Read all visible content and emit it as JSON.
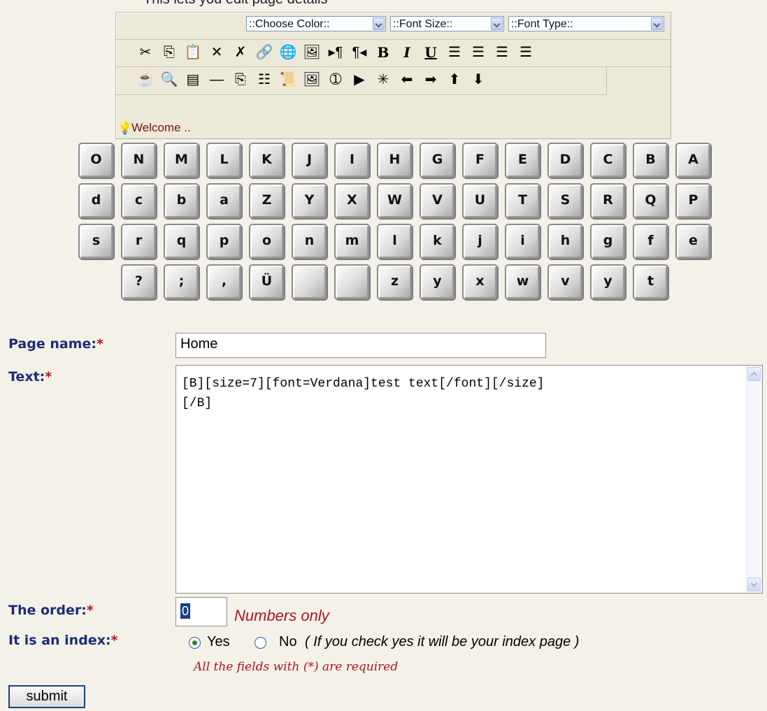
{
  "top_note": "This lets you edit page details",
  "editor": {
    "color_select": "::Choose Color::",
    "size_select": "::Font Size::",
    "type_select": "::Font Type::",
    "status": "Welcome .."
  },
  "toolbar1": [
    {
      "name": "cut-icon",
      "glyph": "✂"
    },
    {
      "name": "copy-icon",
      "glyph": "⎘"
    },
    {
      "name": "paste-icon",
      "glyph": "📋"
    },
    {
      "name": "delete-icon",
      "glyph": "✕"
    },
    {
      "name": "spellcheck-icon",
      "glyph": "✗"
    },
    {
      "name": "link-icon",
      "glyph": "🔗"
    },
    {
      "name": "web-icon",
      "glyph": "🌐"
    },
    {
      "name": "image-icon",
      "glyph": "🖼"
    },
    {
      "name": "ltr-icon",
      "glyph": "▸¶"
    },
    {
      "name": "rtl-icon",
      "glyph": "¶◂"
    },
    {
      "name": "bold-icon",
      "glyph": "B",
      "text": true
    },
    {
      "name": "italic-icon",
      "glyph": "I",
      "text": true
    },
    {
      "name": "underline-icon",
      "glyph": "U",
      "text": true
    },
    {
      "name": "align-left-icon",
      "glyph": "☰"
    },
    {
      "name": "align-center-icon",
      "glyph": "☰"
    },
    {
      "name": "align-right-icon",
      "glyph": "☰"
    },
    {
      "name": "justify-icon",
      "glyph": "☰"
    }
  ],
  "toolbar2": [
    {
      "name": "java-cup-icon",
      "glyph": "☕"
    },
    {
      "name": "find-icon",
      "glyph": "🔍"
    },
    {
      "name": "form-icon",
      "glyph": "▤"
    },
    {
      "name": "hr-line-icon",
      "glyph": "—"
    },
    {
      "name": "copy2-icon",
      "glyph": "⎘"
    },
    {
      "name": "list-icon",
      "glyph": "☷"
    },
    {
      "name": "scroll-icon",
      "glyph": "📜"
    },
    {
      "name": "picture-icon",
      "glyph": "🖼"
    },
    {
      "name": "info-circle-icon",
      "glyph": "➀"
    },
    {
      "name": "play-icon",
      "glyph": "▶"
    },
    {
      "name": "sparkle-icon",
      "glyph": "✳"
    },
    {
      "name": "arrow-left-icon",
      "glyph": "⬅"
    },
    {
      "name": "arrow-right-icon",
      "glyph": "➡"
    },
    {
      "name": "arrow-up-icon",
      "glyph": "⬆"
    },
    {
      "name": "arrow-down-icon",
      "glyph": "⬇"
    }
  ],
  "keyboard": {
    "row1": [
      "O",
      "N",
      "M",
      "L",
      "K",
      "J",
      "I",
      "H",
      "G",
      "F",
      "E",
      "D",
      "C",
      "B",
      "A"
    ],
    "row2": [
      "d",
      "c",
      "b",
      "a",
      "Z",
      "Y",
      "X",
      "W",
      "V",
      "U",
      "T",
      "S",
      "R",
      "Q",
      "P"
    ],
    "row3": [
      "s",
      "r",
      "q",
      "p",
      "o",
      "n",
      "m",
      "l",
      "k",
      "j",
      "i",
      "h",
      "g",
      "f",
      "e"
    ],
    "row4": [
      "?",
      ";",
      ",",
      "Ü",
      "",
      "",
      "z",
      "y",
      "x",
      "w",
      "v",
      "y",
      "t"
    ]
  },
  "form": {
    "page_name_label": "Page name:",
    "page_name_value": "Home",
    "text_label": "Text:",
    "text_value": "[B][size=7][font=Verdana]test text[/font][/size]\n[/B]",
    "order_label": "The order:",
    "order_value": "0",
    "numbers_only": "Numbers only",
    "index_label": "It is an index:",
    "yes": "Yes",
    "no": "No",
    "hint": "( If you check yes it will be your index page )",
    "required_note": "All the fields with (*) are required",
    "submit": "submit",
    "asterisk": "*"
  }
}
